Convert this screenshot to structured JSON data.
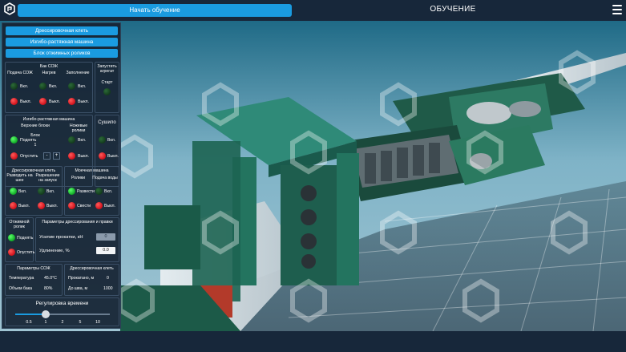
{
  "header": {
    "start_button": "Начать обучение",
    "title": "ОБУЧЕНИЕ"
  },
  "panel": {
    "buttons": [
      "Дрессировочная клеть",
      "Изгибо-растяжная машина",
      "Блок отжимных роликов"
    ],
    "coolant_tank": {
      "title": "Бак СОЖ",
      "col1": "Подача СОЖ",
      "col2": "Нагрев",
      "col3": "Заполнение",
      "on": "Вкл.",
      "off": "Выкл."
    },
    "start_unit": {
      "title": "Запустить агрегат",
      "start": "Старт"
    },
    "bending_machine": {
      "title": "Изгибо-растяжная машина",
      "upper": "Верхние блоки",
      "block_label": "Блок",
      "block_value": "1",
      "raise": "Поднять",
      "lower": "Опустить",
      "minus": "-",
      "plus": "+",
      "knives": "Ножевые ролики",
      "on": "Вкл.",
      "off": "Выкл."
    },
    "dryer": {
      "title": "Сушило",
      "on": "Вкл.",
      "off": "Выкл."
    },
    "stand": {
      "title": "Дрессировочная клеть",
      "unwind": "Разводить на шее",
      "permit": "Разрешение на запуск",
      "on": "Вкл.",
      "off": "Выкл."
    },
    "washing": {
      "title": "Моечная машина",
      "rollers": "Ролики",
      "water": "Подача воды",
      "roll_on": "Развести",
      "roll_off": "Свести",
      "on": "Вкл.",
      "off": "Выкл."
    },
    "squeeze": {
      "title": "Отжимной ролик",
      "raise": "Поднять",
      "lower": "Опустить"
    },
    "params_stand": {
      "title": "Параметры дрессирования и правки",
      "force_label": "Усилие прокатки, кН",
      "force_value": "0",
      "elong_label": "Удлинение, %",
      "elong_value": "0.0"
    },
    "params_coolant": {
      "title": "Параметры СОЖ",
      "temp_label": "Температура",
      "temp_value": "45.0°C",
      "volume_label": "Объем бака",
      "volume_value": "80%"
    },
    "params_stand2": {
      "title": "Дрессировочная клеть",
      "rolled_label": "Прокатано, м",
      "rolled_value": "0",
      "to_end_label": "До шва, м",
      "to_end_value": "1000"
    },
    "time": {
      "title": "Регулировка времени",
      "ticks": [
        "0.5",
        "1",
        "2",
        "5",
        "10"
      ],
      "selected_index": 1
    }
  },
  "colors": {
    "accent": "#1a9be0",
    "bar": "#17273a",
    "on": "#19c42e",
    "off": "#e51b1b"
  }
}
